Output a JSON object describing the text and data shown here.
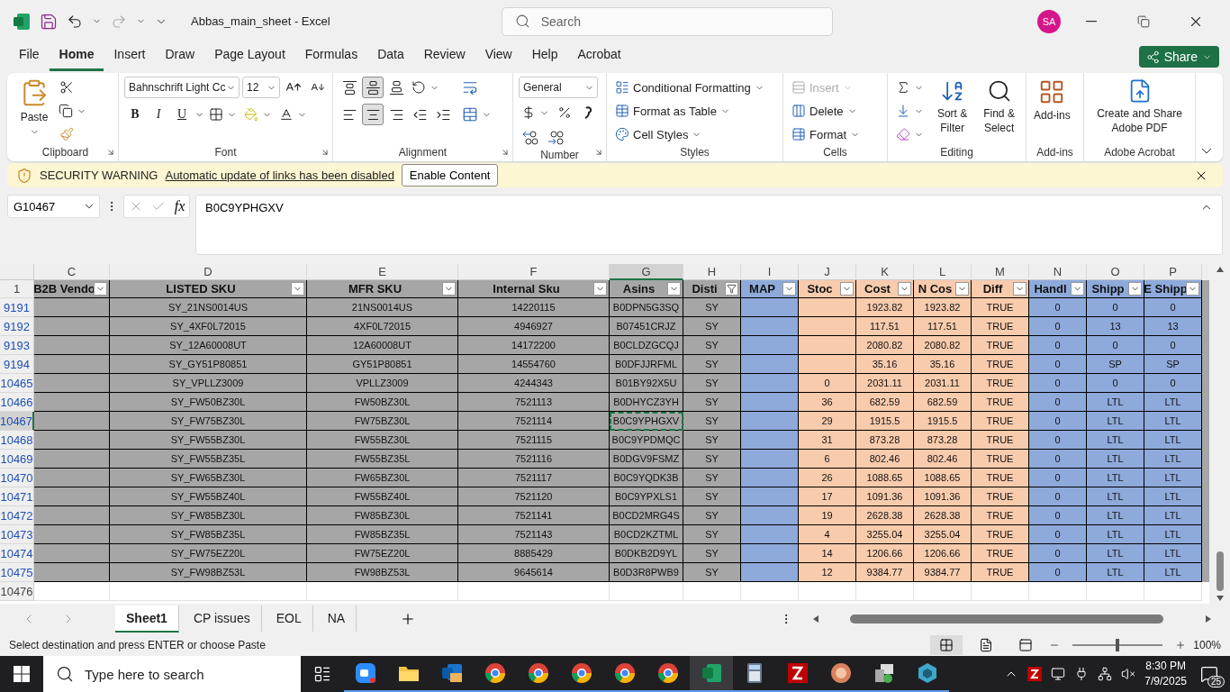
{
  "title_bar": {
    "title": "Abbas_main_sheet  -  Excel",
    "search_placeholder": "Search",
    "avatar": "SA"
  },
  "menu_tabs": [
    {
      "label": "File",
      "selected": false
    },
    {
      "label": "Home",
      "selected": true
    },
    {
      "label": "Insert",
      "selected": false
    },
    {
      "label": "Draw",
      "selected": false
    },
    {
      "label": "Page Layout",
      "selected": false
    },
    {
      "label": "Formulas",
      "selected": false
    },
    {
      "label": "Data",
      "selected": false
    },
    {
      "label": "Review",
      "selected": false
    },
    {
      "label": "View",
      "selected": false
    },
    {
      "label": "Help",
      "selected": false
    },
    {
      "label": "Acrobat",
      "selected": false
    }
  ],
  "share_button": "Share",
  "ribbon": {
    "clipboard": {
      "paste": "Paste",
      "label": "Clipboard"
    },
    "font": {
      "name": "Bahnschrift Light Cc",
      "size": "12",
      "bold": "B",
      "italic": "I",
      "underline": "U",
      "label": "Font"
    },
    "alignment": {
      "buttons": [
        {
          "kind": "top",
          "selected": false
        },
        {
          "kind": "middle",
          "selected": true
        },
        {
          "kind": "bottom",
          "selected": false
        },
        {
          "kind": "left",
          "selected": false
        },
        {
          "kind": "center",
          "selected": true
        },
        {
          "kind": "right",
          "selected": false
        },
        {
          "kind": "outdent",
          "selected": false
        },
        {
          "kind": "indent",
          "selected": false
        }
      ],
      "label": "Alignment"
    },
    "number": {
      "format": "General",
      "label": "Number"
    },
    "styles": {
      "items": [
        "Conditional Formatting",
        "Format as Table",
        "Cell Styles"
      ],
      "label": "Styles"
    },
    "cells": {
      "items": [
        {
          "label": "Insert",
          "disabled": true
        },
        {
          "label": "Delete",
          "disabled": false
        },
        {
          "label": "Format",
          "disabled": false
        }
      ],
      "label": "Cells"
    },
    "editing": {
      "sort_filter": "Sort & Filter",
      "find_select": "Find & Select",
      "label": "Editing"
    },
    "addins": {
      "button": "Add-ins",
      "label": "Add-ins"
    },
    "acrobat": {
      "button": "Create and Share Adobe PDF",
      "label": "Adobe Acrobat"
    }
  },
  "security_bar": {
    "title": "SECURITY WARNING",
    "message": "Automatic update of links has been disabled",
    "button": "Enable Content"
  },
  "formula_bar": {
    "name_box": "G10467",
    "fx": "fx",
    "value": "B0C9YPHGXV"
  },
  "sheet": {
    "columns": [
      {
        "letter": "C",
        "header": "B2B Vendo",
        "color": "#a6a6a6",
        "filtered": false,
        "selected": false
      },
      {
        "letter": "D",
        "header": "LISTED SKU",
        "color": "#a6a6a6",
        "filtered": false,
        "selected": false
      },
      {
        "letter": "E",
        "header": "MFR SKU",
        "color": "#a6a6a6",
        "filtered": false,
        "selected": false
      },
      {
        "letter": "F",
        "header": "Internal Sku",
        "color": "#a6a6a6",
        "filtered": false,
        "selected": false
      },
      {
        "letter": "G",
        "header": "Asins",
        "color": "#a6a6a6",
        "filtered": false,
        "selected": true
      },
      {
        "letter": "H",
        "header": "Disti",
        "color": "#a6a6a6",
        "filtered": true,
        "selected": false
      },
      {
        "letter": "I",
        "header": "MAP",
        "color": "#8eaadb",
        "filtered": false,
        "selected": false
      },
      {
        "letter": "J",
        "header": "Stoc",
        "color": "#f8cbad",
        "filtered": false,
        "selected": false
      },
      {
        "letter": "K",
        "header": "Cost",
        "color": "#f8cbad",
        "filtered": false,
        "selected": false
      },
      {
        "letter": "L",
        "header": "N Cos",
        "color": "#f8cbad",
        "filtered": false,
        "selected": false
      },
      {
        "letter": "M",
        "header": "Diff",
        "color": "#f8cbad",
        "filtered": false,
        "selected": false
      },
      {
        "letter": "N",
        "header": "Handl",
        "color": "#8eaadb",
        "filtered": false,
        "selected": false
      },
      {
        "letter": "O",
        "header": "Shipp",
        "color": "#8eaadb",
        "filtered": false,
        "selected": false
      },
      {
        "letter": "P",
        "header": "E Shipp",
        "color": "#8eaadb",
        "filtered": false,
        "selected": false
      }
    ],
    "header_row": "1",
    "rows": [
      {
        "number": "9191",
        "selected": false,
        "cells": [
          null,
          "SY_21NS0014US",
          "21NS0014US",
          "14220115",
          "B0DPN5G3SQ",
          "SY",
          null,
          null,
          "1923.82",
          "1923.82",
          "TRUE",
          "0",
          "0",
          "0"
        ]
      },
      {
        "number": "9192",
        "selected": false,
        "cells": [
          null,
          "SY_4XF0L72015",
          "4XF0L72015",
          "4946927",
          "B07451CRJZ",
          "SY",
          null,
          null,
          "117.51",
          "117.51",
          "TRUE",
          "0",
          "13",
          "13"
        ]
      },
      {
        "number": "9193",
        "selected": false,
        "cells": [
          null,
          "SY_12A60008UT",
          "12A60008UT",
          "14172200",
          "B0CLDZGCQJ",
          "SY",
          null,
          null,
          "2080.82",
          "2080.82",
          "TRUE",
          "0",
          "0",
          "0"
        ]
      },
      {
        "number": "9194",
        "selected": false,
        "cells": [
          null,
          "SY_GY51P80851",
          "GY51P80851",
          "14554760",
          "B0DFJJRFML",
          "SY",
          null,
          null,
          "35.16",
          "35.16",
          "TRUE",
          "0",
          "SP",
          "SP"
        ]
      },
      {
        "number": "10465",
        "selected": false,
        "cells": [
          null,
          "SY_VPLLZ3009",
          "VPLLZ3009",
          "4244343",
          "B01BY92X5U",
          "SY",
          null,
          "0",
          "2031.11",
          "2031.11",
          "TRUE",
          "0",
          "0",
          "0"
        ]
      },
      {
        "number": "10466",
        "selected": false,
        "cells": [
          null,
          "SY_FW50BZ30L",
          "FW50BZ30L",
          "7521113",
          "B0DHYCZ3YH",
          "SY",
          null,
          "36",
          "682.59",
          "682.59",
          "TRUE",
          "0",
          "LTL",
          "LTL"
        ]
      },
      {
        "number": "10467",
        "selected": true,
        "cells": [
          null,
          "SY_FW75BZ30L",
          "FW75BZ30L",
          "7521114",
          "B0C9YPHGXV",
          "SY",
          null,
          "29",
          "1915.5",
          "1915.5",
          "TRUE",
          "0",
          "LTL",
          "LTL"
        ]
      },
      {
        "number": "10468",
        "selected": false,
        "cells": [
          null,
          "SY_FW55BZ30L",
          "FW55BZ30L",
          "7521115",
          "B0C9YPDMQC",
          "SY",
          null,
          "31",
          "873.28",
          "873.28",
          "TRUE",
          "0",
          "LTL",
          "LTL"
        ]
      },
      {
        "number": "10469",
        "selected": false,
        "cells": [
          null,
          "SY_FW55BZ35L",
          "FW55BZ35L",
          "7521116",
          "B0DGV9FSMZ",
          "SY",
          null,
          "6",
          "802.46",
          "802.46",
          "TRUE",
          "0",
          "LTL",
          "LTL"
        ]
      },
      {
        "number": "10470",
        "selected": false,
        "cells": [
          null,
          "SY_FW65BZ30L",
          "FW65BZ30L",
          "7521117",
          "B0C9YQDK3B",
          "SY",
          null,
          "26",
          "1088.65",
          "1088.65",
          "TRUE",
          "0",
          "LTL",
          "LTL"
        ]
      },
      {
        "number": "10471",
        "selected": false,
        "cells": [
          null,
          "SY_FW55BZ40L",
          "FW55BZ40L",
          "7521120",
          "B0C9YPXLS1",
          "SY",
          null,
          "17",
          "1091.36",
          "1091.36",
          "TRUE",
          "0",
          "LTL",
          "LTL"
        ]
      },
      {
        "number": "10472",
        "selected": false,
        "cells": [
          null,
          "SY_FW85BZ30L",
          "FW85BZ30L",
          "7521141",
          "B0CD2MRG4S",
          "SY",
          null,
          "19",
          "2628.38",
          "2628.38",
          "TRUE",
          "0",
          "LTL",
          "LTL"
        ]
      },
      {
        "number": "10473",
        "selected": false,
        "cells": [
          null,
          "SY_FW85BZ35L",
          "FW85BZ35L",
          "7521143",
          "B0CD2KZTML",
          "SY",
          null,
          "4",
          "3255.04",
          "3255.04",
          "TRUE",
          "0",
          "LTL",
          "LTL"
        ]
      },
      {
        "number": "10474",
        "selected": false,
        "cells": [
          null,
          "SY_FW75EZ20L",
          "FW75EZ20L",
          "8885429",
          "B0DKB2D9YL",
          "SY",
          null,
          "14",
          "1206.66",
          "1206.66",
          "TRUE",
          "0",
          "LTL",
          "LTL"
        ]
      },
      {
        "number": "10475",
        "selected": false,
        "cells": [
          null,
          "SY_FW98BZ53L",
          "FW98BZ53L",
          "9645614",
          "B0D3R8PWB9",
          "SY",
          null,
          "12",
          "9384.77",
          "9384.77",
          "TRUE",
          "0",
          "LTL",
          "LTL"
        ]
      },
      {
        "number": "10476",
        "selected": false,
        "cells": []
      }
    ]
  },
  "sheet_tabs": [
    {
      "label": "Sheet1",
      "selected": true
    },
    {
      "label": "CP issues",
      "selected": false
    },
    {
      "label": "EOL",
      "selected": false
    },
    {
      "label": "NA",
      "selected": false
    }
  ],
  "status_bar": {
    "message": "Select destination and press ENTER or choose Paste",
    "zoom": "100%",
    "zoom_slider": {
      "level": 0.5
    }
  },
  "taskbar": {
    "search_placeholder": "Type here to search",
    "apps": [
      {
        "kind": "meeting",
        "active": false
      },
      {
        "kind": "folder",
        "active": false
      },
      {
        "kind": "mail",
        "active": false
      },
      {
        "kind": "browser",
        "active": false
      },
      {
        "kind": "browser",
        "active": false
      },
      {
        "kind": "browser",
        "active": false
      },
      {
        "kind": "browser",
        "active": false
      },
      {
        "kind": "browser",
        "active": false
      },
      {
        "kind": "spreadsheet",
        "active": true
      },
      {
        "kind": "calculator",
        "active": false
      },
      {
        "kind": "ftp",
        "active": false
      },
      {
        "kind": "disc",
        "active": false
      },
      {
        "kind": "monitor",
        "active": false
      },
      {
        "kind": "hexagon",
        "active": false
      }
    ],
    "time": "8:30 PM",
    "date": "7/9/2025",
    "notifications": "25"
  }
}
